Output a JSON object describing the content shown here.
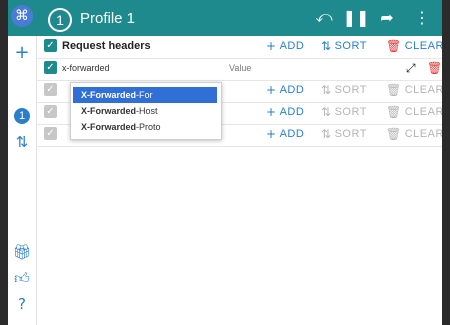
{
  "app": {
    "logo_glyph": "⌘",
    "profile_number": "1",
    "profile_title": "Profile 1",
    "accent_color": "#1f8a8d"
  },
  "topbar": {
    "undo_icon": "undo-icon",
    "pause_icon": "pause-icon",
    "share_icon": "share-icon",
    "more_icon": "more-icon"
  },
  "sidebar": {
    "add_icon": "plus-icon",
    "active_profile": "1",
    "sort_icon": "sort-icon",
    "gift_icon": "gift-icon",
    "thumbs_icon": "thumbs-up-icon",
    "help_icon": "help-icon"
  },
  "section": {
    "title": "Request headers",
    "add_label": "ADD",
    "sort_label": "SORT",
    "clear_label": "CLEAR"
  },
  "header_row": {
    "name_value": "x-forwarded",
    "value_placeholder": "Value"
  },
  "autocomplete": {
    "items": [
      {
        "match": "X-Forwarded",
        "rest": "-For"
      },
      {
        "match": "X-Forwarded",
        "rest": "-Host"
      },
      {
        "match": "X-Forwarded",
        "rest": "-Proto"
      }
    ]
  },
  "disabled_rows": [
    {
      "add_label": "ADD",
      "sort_label": "SORT",
      "clear_label": "CLEAR"
    },
    {
      "add_label": "ADD",
      "sort_label": "SORT",
      "clear_label": "CLEAR"
    },
    {
      "add_label": "ADD",
      "sort_label": "SORT",
      "clear_label": "CLEAR"
    }
  ]
}
